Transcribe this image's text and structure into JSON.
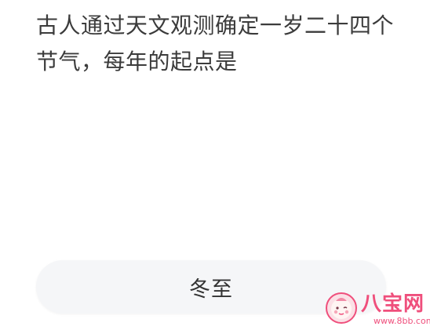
{
  "question": {
    "text": "古人通过天文观测确定一岁二十四个节气，每年的起点是"
  },
  "answer_option": {
    "label": "冬至"
  },
  "watermark": {
    "brand": "八宝网",
    "url": "www.8bb.com",
    "color": "#ef4f7c"
  }
}
